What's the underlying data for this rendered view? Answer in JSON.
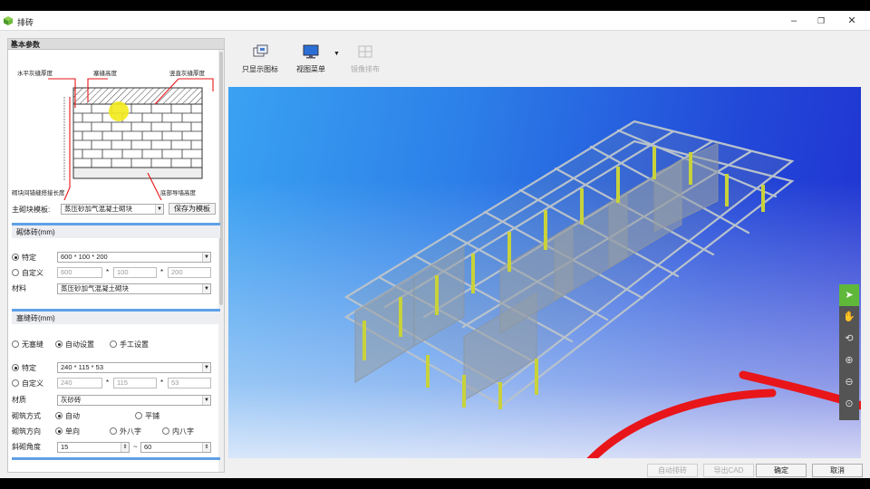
{
  "window": {
    "title": "排砖"
  },
  "panel": {
    "title": "基本参数",
    "diagram_labels": {
      "horizontal_joint": "水平灰缝厚度",
      "top_height": "塞缝高度",
      "vertical_joint": "竖直灰缝厚度",
      "bond_length": "砌块间错缝搭接长度",
      "bottom_height": "底部导墙高度"
    },
    "template_label": "主砌块模板:",
    "template_value": "蒸压砂加气混凝土砌块",
    "save_template": "保存为模板",
    "masonry": {
      "section_title": "砌体砖(mm)",
      "opt_specific": "特定",
      "specific_value": "600 * 100 * 200",
      "opt_custom": "自定义",
      "custom_l": "600",
      "custom_w": "100",
      "custom_h": "200",
      "material_label": "材料",
      "material_value": "蒸压砂加气混凝土砌块"
    },
    "plug": {
      "section_title": "塞缝砖(mm)",
      "opt_none": "无塞缝",
      "opt_auto": "自动设置",
      "opt_manual": "手工设置",
      "opt_specific": "特定",
      "specific_value": "240 * 115 * 53",
      "opt_custom": "自定义",
      "custom_l": "240",
      "custom_w": "115",
      "custom_h": "53",
      "material_label": "材质",
      "material_value": "灰砂砖",
      "method_label": "砌筑方式",
      "method_auto": "自动",
      "method_flat": "平铺",
      "dir_label": "砌筑方向",
      "dir_single": "单向",
      "dir_outer": "外八字",
      "dir_inner": "内八字",
      "angle_label": "斜砌角度",
      "angle_from": "15",
      "angle_sep": "~",
      "angle_to": "60"
    }
  },
  "toolbar": {
    "show_icon_only": "只显示图标",
    "view_menu": "视图菜单",
    "mirror_layout": "镜像排布"
  },
  "buttons": {
    "auto_layout": "自动排砖",
    "export_cad": "导出CAD",
    "ok": "确定",
    "cancel": "取消"
  },
  "colors": {
    "accent": "#5ea0e6",
    "tool_active": "#5fb83a",
    "annotation_red": "#e8161a"
  }
}
